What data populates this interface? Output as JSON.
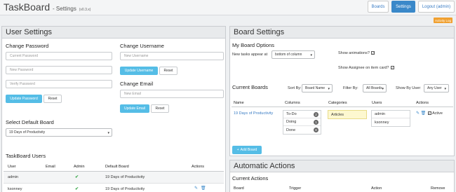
{
  "header": {
    "app_title": "TaskBoard",
    "page_subtitle": "- Settings",
    "version": "(v0.3.x)",
    "nav": {
      "boards": "Boards",
      "settings": "Settings",
      "logout": "Logout (admin)"
    },
    "activity_log": "Activity Log"
  },
  "user_settings": {
    "title": "User Settings",
    "change_password": {
      "heading": "Change Password",
      "current_placeholder": "Current Password",
      "new_placeholder": "New Password",
      "verify_placeholder": "Verify Password",
      "update_label": "Update Password",
      "reset_label": "Reset"
    },
    "change_username": {
      "heading": "Change Username",
      "placeholder": "New Username",
      "update_label": "Update Username",
      "reset_label": "Reset"
    },
    "change_email": {
      "heading": "Change Email",
      "placeholder": "New Email",
      "update_label": "Update Email",
      "reset_label": "Reset"
    },
    "default_board": {
      "heading": "Select Default Board",
      "selected": "19 Days of Productivity"
    },
    "users_table": {
      "heading": "TaskBoard Users",
      "columns": [
        "User",
        "Email",
        "Admin",
        "Default Board",
        "Actions"
      ],
      "rows": [
        {
          "user": "admin",
          "email": "",
          "admin": true,
          "default_board": "19 Days of Productivity"
        },
        {
          "user": "ksonney",
          "email": "",
          "admin": true,
          "default_board": "19 Days of Productivity"
        }
      ]
    }
  },
  "board_settings": {
    "title": "Board Settings",
    "options": {
      "heading": "My Board Options",
      "new_tasks_label": "New tasks appear at",
      "new_tasks_value": "bottom of column",
      "show_animations_label": "Show animations?",
      "show_assignee_label": "Show Assignee on item card?"
    },
    "current_boards": {
      "heading": "Current Boards",
      "sort_label": "Sort By:",
      "sort_value": "Board Name",
      "filter_label": "Filter By:",
      "filter_value": "All Boards",
      "show_by_user_label": "Show By User:",
      "show_by_user_value": "Any User",
      "columns": [
        "Name",
        "Columns",
        "Categories",
        "Users",
        "Actions"
      ],
      "board": {
        "name": "19 Days of Productivity",
        "lanes": [
          {
            "name": "To-Do",
            "count": "2"
          },
          {
            "name": "Doing",
            "count": "1"
          },
          {
            "name": "Done",
            "count": "8"
          }
        ],
        "categories": [
          "Articles"
        ],
        "users": [
          "admin",
          "ksonney"
        ],
        "active_label": "Active"
      },
      "add_board_label": "Add Board"
    }
  },
  "automatic_actions": {
    "title": "Automatic Actions",
    "current_heading": "Current Actions",
    "columns": [
      "Board",
      "Trigger",
      "Action",
      "Remove"
    ]
  }
}
